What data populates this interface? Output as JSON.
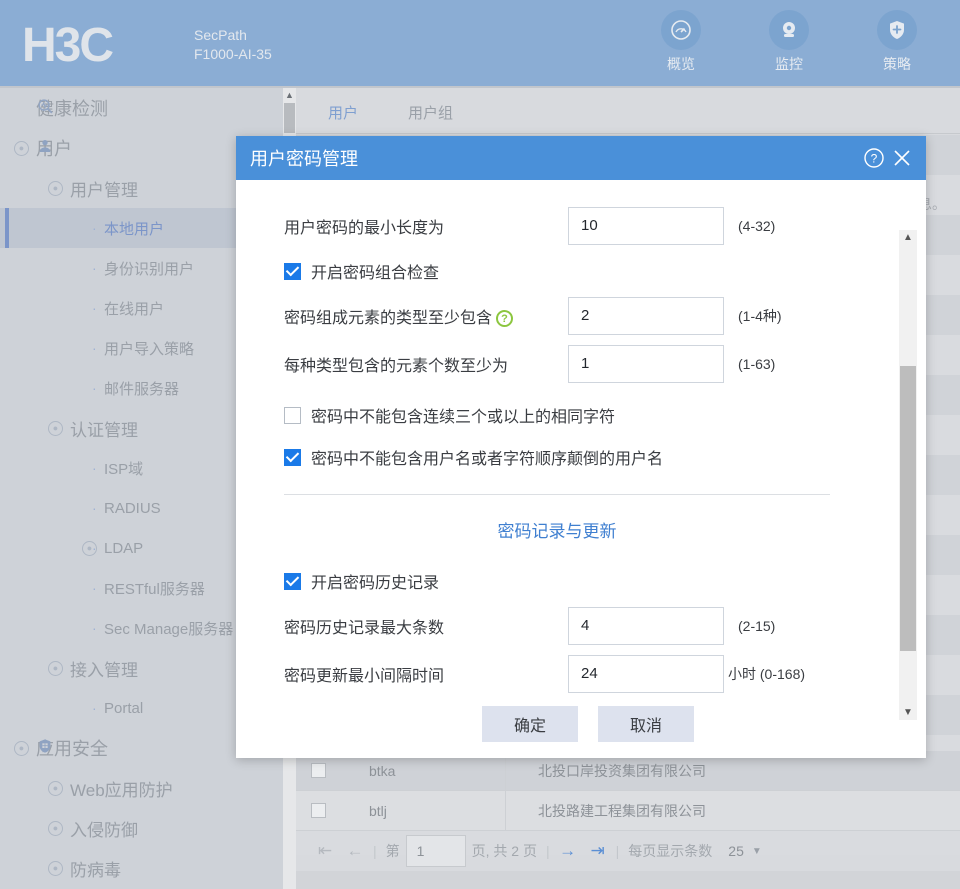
{
  "header": {
    "logo": "H3C",
    "product_line1": "SecPath",
    "product_line2": "F1000-AI-35",
    "nav": [
      {
        "label": "概览",
        "icon": "gauge-icon"
      },
      {
        "label": "监控",
        "icon": "monitor-icon"
      },
      {
        "label": "策略",
        "icon": "shield-icon"
      }
    ],
    "brand_color": "#8badd4"
  },
  "sidebar": {
    "items": [
      {
        "label": "健康检测",
        "level": 0,
        "icon": "health-search-icon",
        "caret": false,
        "active": false
      },
      {
        "label": "用户",
        "level": 0,
        "icon": "user-icon",
        "caret": true,
        "active": false
      },
      {
        "label": "用户管理",
        "level": 1,
        "caret": true,
        "active": false
      },
      {
        "label": "本地用户",
        "level": 2,
        "bullet": true,
        "active": true
      },
      {
        "label": "身份识别用户",
        "level": 2,
        "bullet": true,
        "active": false
      },
      {
        "label": "在线用户",
        "level": 2,
        "bullet": true,
        "active": false
      },
      {
        "label": "用户导入策略",
        "level": 2,
        "bullet": true,
        "active": false
      },
      {
        "label": "邮件服务器",
        "level": 2,
        "bullet": true,
        "active": false
      },
      {
        "label": "认证管理",
        "level": 1,
        "caret": true,
        "active": false
      },
      {
        "label": "ISP域",
        "level": 2,
        "bullet": true,
        "active": false
      },
      {
        "label": "RADIUS",
        "level": 2,
        "bullet": true,
        "active": false
      },
      {
        "label": "LDAP",
        "level": 2,
        "bullet": true,
        "caret": true,
        "active": false
      },
      {
        "label": "RESTful服务器",
        "level": 2,
        "bullet": true,
        "active": false
      },
      {
        "label": "Sec Manage服务器",
        "level": 2,
        "bullet": true,
        "active": false
      },
      {
        "label": "接入管理",
        "level": 1,
        "caret": true,
        "active": false
      },
      {
        "label": "Portal",
        "level": 2,
        "bullet": true,
        "active": false
      },
      {
        "label": "应用安全",
        "level": 0,
        "icon": "app-security-icon",
        "caret": true,
        "active": false
      },
      {
        "label": "Web应用防护",
        "level": 1,
        "caret": true,
        "active": false
      },
      {
        "label": "入侵防御",
        "level": 1,
        "caret": true,
        "active": false
      },
      {
        "label": "防病毒",
        "level": 1,
        "caret": true,
        "active": false
      }
    ]
  },
  "content": {
    "tabs": [
      {
        "label": "用户",
        "active": true
      },
      {
        "label": "用户组",
        "active": false
      }
    ],
    "note_fragment": "息。",
    "table": {
      "rows": [
        {
          "name": "btka",
          "description": "北投口岸投资集团有限公司"
        },
        {
          "name": "btlj",
          "description": "北投路建工程集团有限公司"
        }
      ]
    },
    "pager": {
      "first_icon": "first-page-icon",
      "prev_icon": "prev-page-icon",
      "next_icon": "next-page-icon",
      "last_icon": "last-page-icon",
      "page_prefix": "第",
      "page_value": "1",
      "page_suffix": "页, 共 2 页",
      "page_size_label": "每页显示条数",
      "page_size_value": "25"
    }
  },
  "dialog": {
    "title": "用户密码管理",
    "help_icon": "help-circle-icon",
    "close_icon": "close-icon",
    "min_length": {
      "label": "用户密码的最小长度为",
      "value": "10",
      "range": "(4-32)"
    },
    "enable_composition_check": {
      "label": "开启密码组合检查",
      "checked": true
    },
    "element_types": {
      "label": "密码组成元素的类型至少包含",
      "help_icon": "help-green-icon",
      "value": "2",
      "range": "(1-4种)"
    },
    "elements_per_type": {
      "label": "每种类型包含的元素个数至少为",
      "value": "1",
      "range": "(1-63)"
    },
    "no_repeat_chars": {
      "label": "密码中不能包含连续三个或以上的相同字符",
      "checked": false
    },
    "no_username": {
      "label": "密码中不能包含用户名或者字符顺序颠倒的用户名",
      "checked": true
    },
    "section_title": "密码记录与更新",
    "enable_history": {
      "label": "开启密码历史记录",
      "checked": true
    },
    "history_max": {
      "label": "密码历史记录最大条数",
      "value": "4",
      "range": "(2-15)"
    },
    "update_interval": {
      "label": "密码更新最小间隔时间",
      "value": "24",
      "range": "小时 (0-168)"
    },
    "ok_label": "确定",
    "cancel_label": "取消",
    "title_color": "#4a90d9",
    "accent_color": "#1a7ae8",
    "help_green": "#8cc63f"
  }
}
